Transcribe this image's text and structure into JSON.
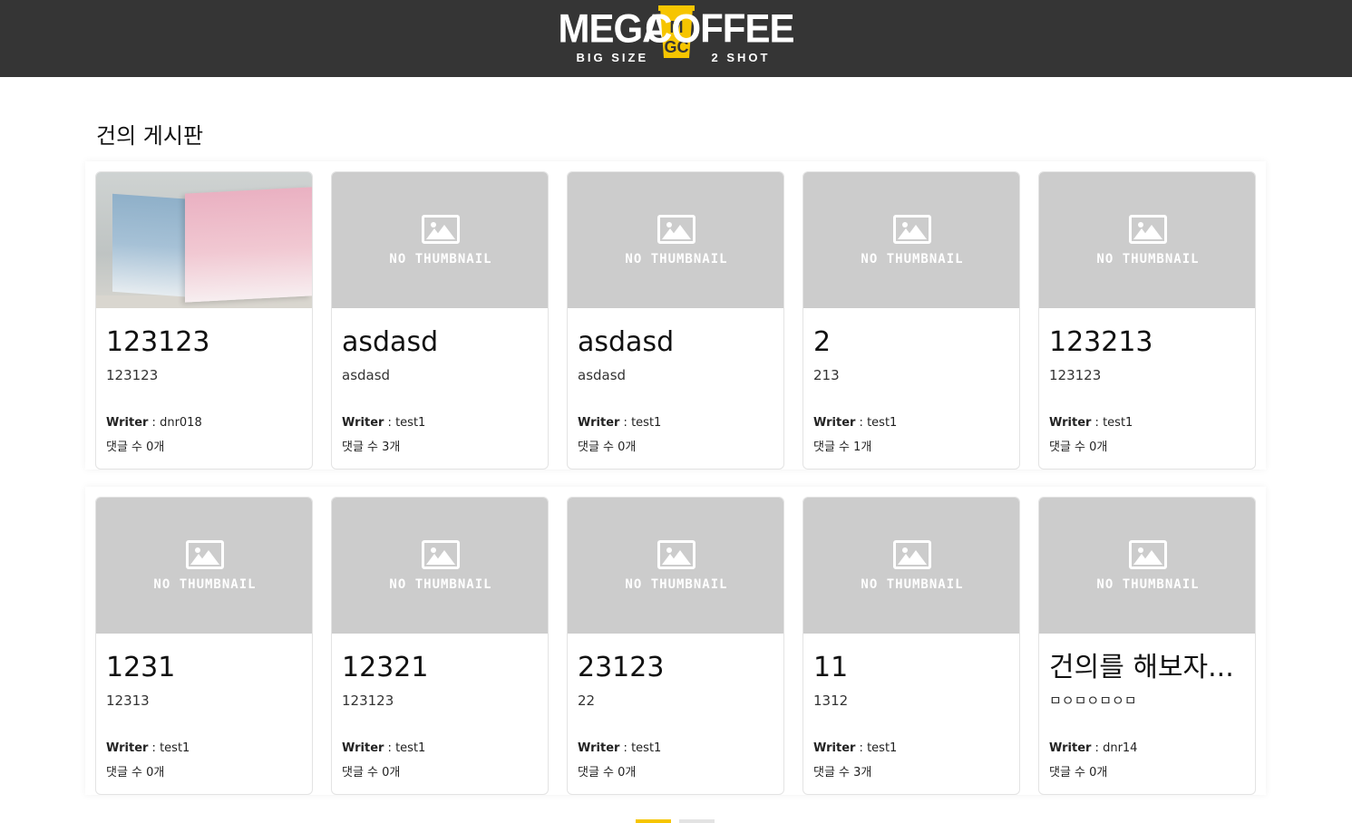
{
  "header": {
    "brand_left": "MEGA",
    "brand_right": "COFFEE",
    "brand_mark": "MGC",
    "tagline_left": "BIG SIZE",
    "tagline_right": "2 SHOT",
    "bar_color": "#353535",
    "accent_color": "#f6c500"
  },
  "board": {
    "title": "건의 게시판"
  },
  "posts": [
    {
      "title": "123123",
      "content": "123123",
      "writer_label": "Writer",
      "writer": "dnr018",
      "comments_text": "댓글 수 0개",
      "thumbnail": "photo"
    },
    {
      "title": "asdasd",
      "content": "asdasd",
      "writer_label": "Writer",
      "writer": "test1",
      "comments_text": "댓글 수 3개",
      "thumbnail": "NO THUMBNAIL"
    },
    {
      "title": "asdasd",
      "content": "asdasd",
      "writer_label": "Writer",
      "writer": "test1",
      "comments_text": "댓글 수 0개",
      "thumbnail": "NO THUMBNAIL"
    },
    {
      "title": "2",
      "content": "213",
      "writer_label": "Writer",
      "writer": "test1",
      "comments_text": "댓글 수 1개",
      "thumbnail": "NO THUMBNAIL"
    },
    {
      "title": "123213",
      "content": "123123",
      "writer_label": "Writer",
      "writer": "test1",
      "comments_text": "댓글 수 0개",
      "thumbnail": "NO THUMBNAIL"
    },
    {
      "title": "1231",
      "content": "12313",
      "writer_label": "Writer",
      "writer": "test1",
      "comments_text": "댓글 수 0개",
      "thumbnail": "NO THUMBNAIL"
    },
    {
      "title": "12321",
      "content": "123123",
      "writer_label": "Writer",
      "writer": "test1",
      "comments_text": "댓글 수 0개",
      "thumbnail": "NO THUMBNAIL"
    },
    {
      "title": "23123",
      "content": "22",
      "writer_label": "Writer",
      "writer": "test1",
      "comments_text": "댓글 수 0개",
      "thumbnail": "NO THUMBNAIL"
    },
    {
      "title": "11",
      "content": "1312",
      "writer_label": "Writer",
      "writer": "test1",
      "comments_text": "댓글 수 3개",
      "thumbnail": "NO THUMBNAIL"
    },
    {
      "title": "건의를 해보자...",
      "content": "ㅁㅇㅁㅇㅁㅇㅁ",
      "writer_label": "Writer",
      "writer": "dnr14",
      "comments_text": "댓글 수 0개",
      "thumbnail": "NO THUMBNAIL"
    }
  ]
}
